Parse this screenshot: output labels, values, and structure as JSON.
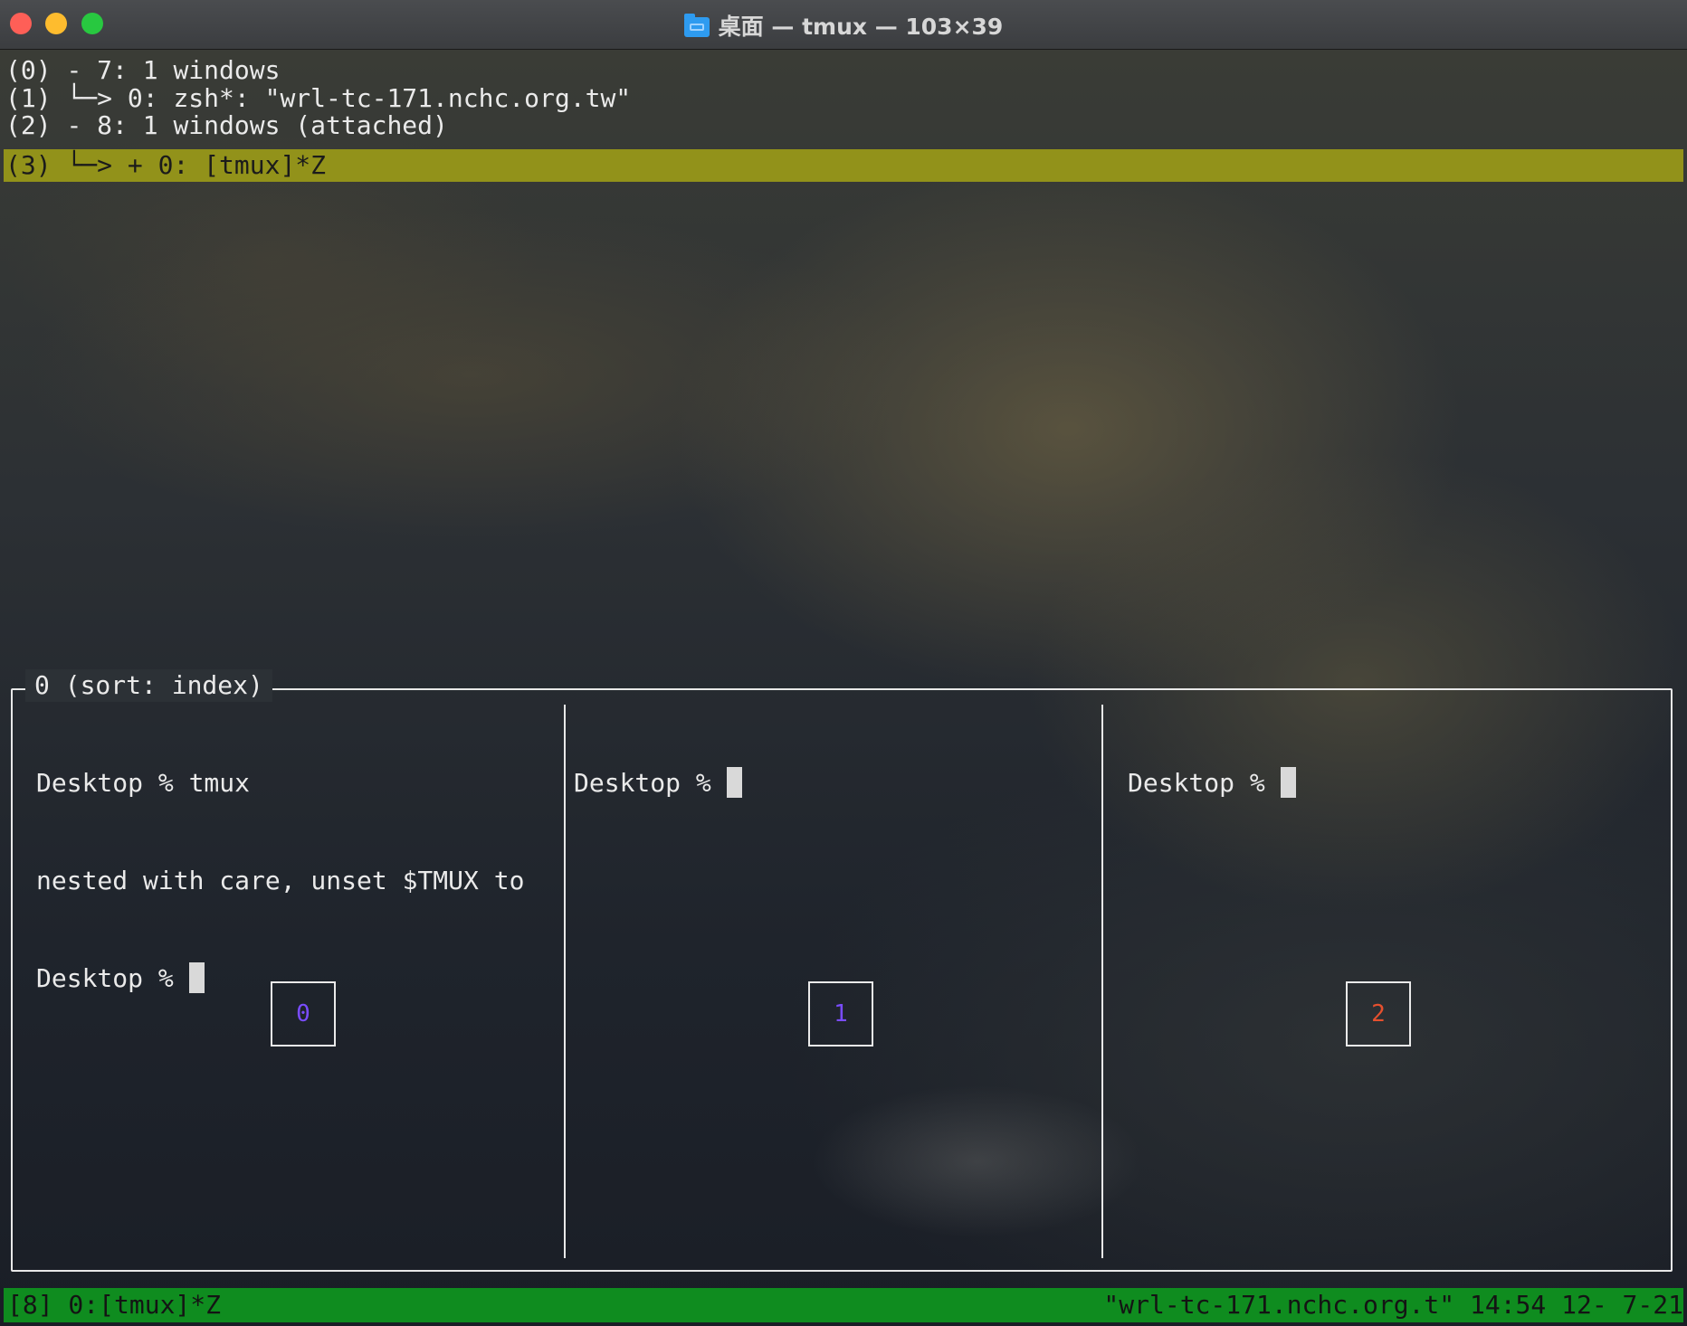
{
  "window": {
    "title": "桌面 — tmux — 103×39"
  },
  "tree": [
    {
      "index": "(0)",
      "text": "- 7: 1 windows"
    },
    {
      "index": "(1)",
      "text": "└─> 0: zsh*: \"wrl-tc-171.nchc.org.tw\""
    },
    {
      "index": "(2)",
      "text": "- 8: 1 windows (attached)"
    },
    {
      "index": "(3)",
      "text": "└─> + 0: [tmux]*Z"
    }
  ],
  "preview": {
    "title": "0 (sort: index)",
    "panes": [
      {
        "lines": [
          "Desktop % tmux",
          "nested with care, unset $TMUX to",
          "Desktop % "
        ],
        "number": "0",
        "number_color": "#7a4cff"
      },
      {
        "lines": [
          "Desktop % "
        ],
        "number": "1",
        "number_color": "#7a4cff"
      },
      {
        "lines": [
          "Desktop % "
        ],
        "number": "2",
        "number_color": "#e6502e"
      }
    ]
  },
  "status_bar": {
    "left": "[8] 0:[tmux]*Z",
    "right": "\"wrl-tc-171.nchc.org.t\" 14:54 12- 7-21",
    "color": "#0f8c1f"
  },
  "colors": {
    "selection_highlight": "#9a9a18"
  }
}
